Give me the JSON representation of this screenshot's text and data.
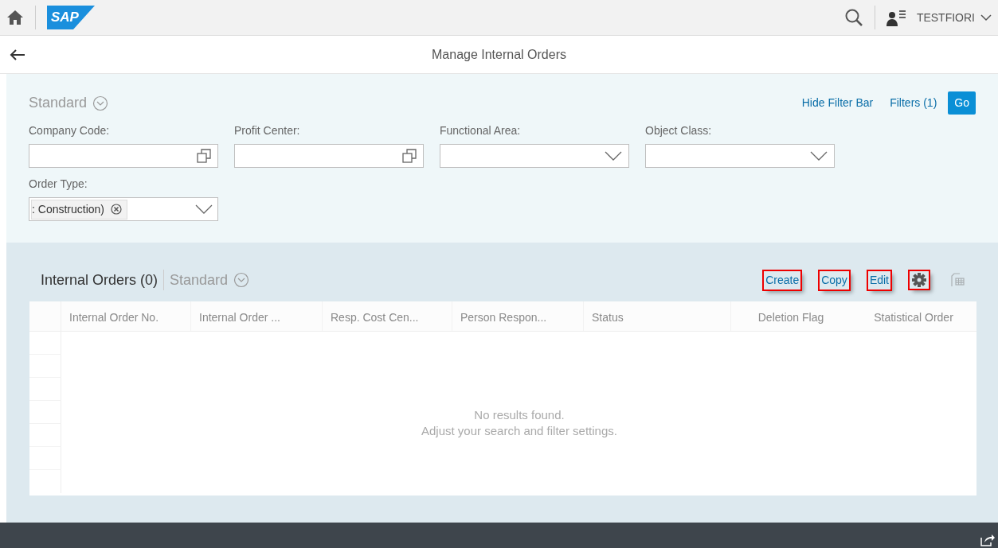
{
  "shell": {
    "logo": "SAP",
    "user": "TESTFIORI"
  },
  "page": {
    "title": "Manage Internal Orders"
  },
  "filter_bar": {
    "variant": "Standard",
    "hide_link": "Hide Filter Bar",
    "filters_link": "Filters (1)",
    "go_button": "Go",
    "fields": [
      {
        "label": "Company Code:",
        "kind": "valuehelp"
      },
      {
        "label": "Profit Center:",
        "kind": "valuehelp"
      },
      {
        "label": "Functional Area:",
        "kind": "select"
      },
      {
        "label": "Object Class:",
        "kind": "select"
      },
      {
        "label": "Order Type:",
        "kind": "tokens",
        "tokens": [
          ": Construction)"
        ]
      }
    ]
  },
  "table": {
    "title": "Internal Orders (0)",
    "variant": "Standard",
    "toolbar": [
      {
        "kind": "text",
        "label": "Create",
        "highlighted": true,
        "disabled": false
      },
      {
        "kind": "text",
        "label": "Copy",
        "highlighted": true,
        "disabled": false
      },
      {
        "kind": "text",
        "label": "Edit",
        "highlighted": true,
        "disabled": false
      },
      {
        "kind": "settings",
        "highlighted": true,
        "disabled": false
      },
      {
        "kind": "export",
        "highlighted": false,
        "disabled": true
      }
    ],
    "columns": [
      "Internal Order No.",
      "Internal Order ...",
      "Resp. Cost Cen...",
      "Person Respon...",
      "Status",
      "Deletion Flag",
      "Statistical Order"
    ],
    "empty_title": "No results found.",
    "empty_hint": "Adjust your search and filter settings."
  }
}
